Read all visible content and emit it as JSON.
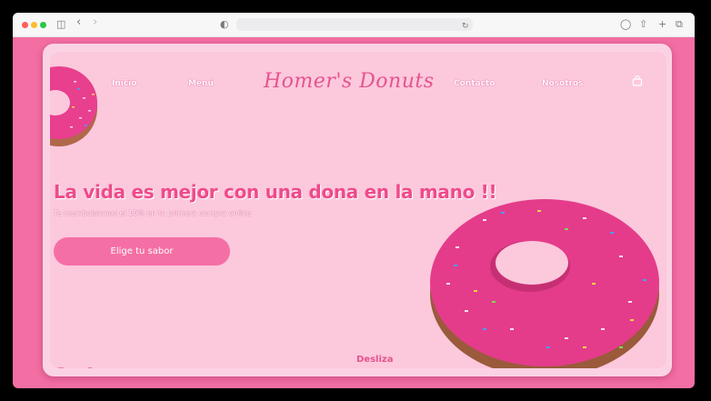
{
  "site": {
    "brand": "Homer's Donuts",
    "nav": [
      "Inicio",
      "Menú",
      "Contacto",
      "Nosotros"
    ],
    "headline": "La vida es mejor con una dona en la mano !!",
    "subheadline": "Te reembolsamos el 10% en tu primera compra online",
    "cta_label": "Elige tu sabor",
    "scroll_label": "Desliza"
  },
  "icons": {
    "cart": "shopping-bag-icon",
    "social": [
      "instagram-icon",
      "twitter-icon",
      "facebook-icon"
    ]
  },
  "colors": {
    "page_bg": "#f36ea3",
    "panel_bg": "#fcc8dc",
    "accent": "#ee4b8b",
    "button_bg": "#f46fa5"
  }
}
